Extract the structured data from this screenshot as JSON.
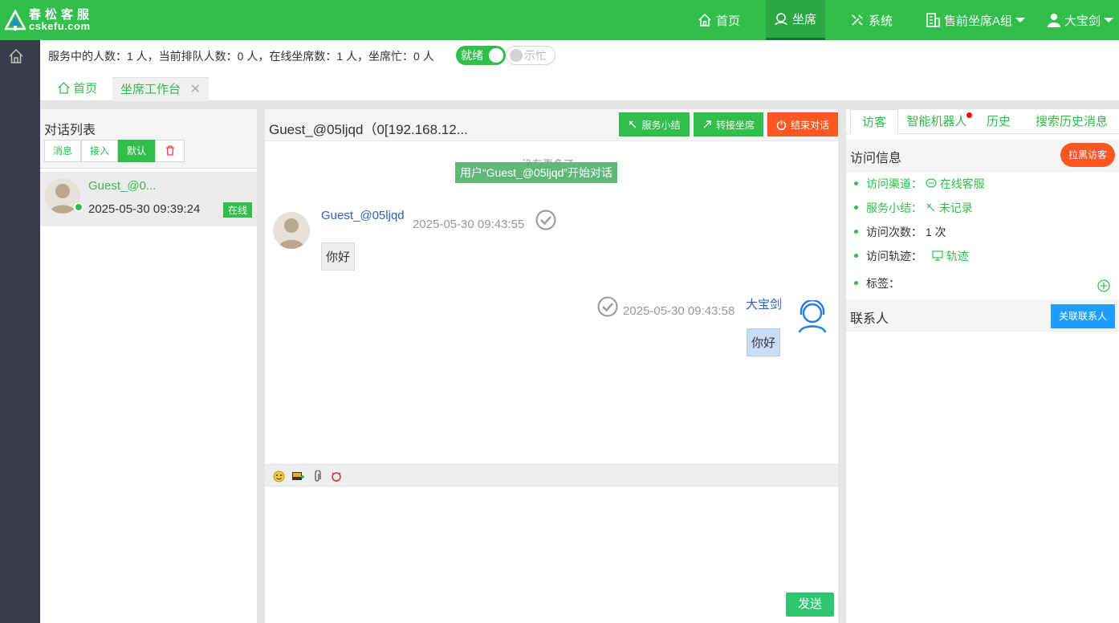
{
  "app": {
    "logo_cn": "春松客服",
    "logo_en": "cskefu.com"
  },
  "nav": {
    "home": "首页",
    "agent": "坐席",
    "system": "系统",
    "group": "售前坐席A组",
    "user": "大宝剑"
  },
  "status": {
    "text": "服务中的人数：1 人，当前排队人数：0 人，在线坐席数：1 人，坐席忙：0 人",
    "ready_label": "就绪",
    "busy_label": "示忙"
  },
  "tabs": {
    "home": "首页",
    "workbench": "坐席工作台",
    "close": "✕"
  },
  "convlist": {
    "title": "对话列表",
    "filters": [
      "消息",
      "接入",
      "默认"
    ],
    "item": {
      "name": "Guest_@0...",
      "time": "2025-05-30 09:39:24",
      "badge": "在线"
    }
  },
  "chat": {
    "title": "Guest_@05ljqd（0[192.168.12...",
    "btn_summary": "服务小结",
    "btn_transfer": "转接坐席",
    "btn_end": "结束对话",
    "no_more": "没有更多了",
    "system_message": "用户“Guest_@05ljqd”开始对话",
    "messages": [
      {
        "from": "Guest_@05ljqd",
        "time": "2025-05-30 09:43:55",
        "text": "你好"
      },
      {
        "from": "大宝剑",
        "time": "2025-05-30 09:43:58",
        "text": "你好"
      }
    ],
    "send": "发送"
  },
  "right": {
    "tabs": [
      "访客",
      "智能机器人",
      "历史",
      "搜索历史消息"
    ],
    "visit_title": "访问信息",
    "blacklist_btn": "拉黑访客",
    "rows": [
      {
        "label": "访问渠道：",
        "value": "在线客服"
      },
      {
        "label": "服务小结：",
        "value": "未记录"
      },
      {
        "label": "访问次数：",
        "value": "1 次"
      },
      {
        "label": "访问轨迹：",
        "value": "轨迹"
      },
      {
        "label": "标签：",
        "value": ""
      }
    ],
    "contacts_title": "联系人",
    "link_contact_btn": "关联联系人"
  },
  "colors": {
    "brand": "#32be4b",
    "danger": "#ff5722",
    "info": "#1e9fff",
    "rail": "#393d49"
  }
}
